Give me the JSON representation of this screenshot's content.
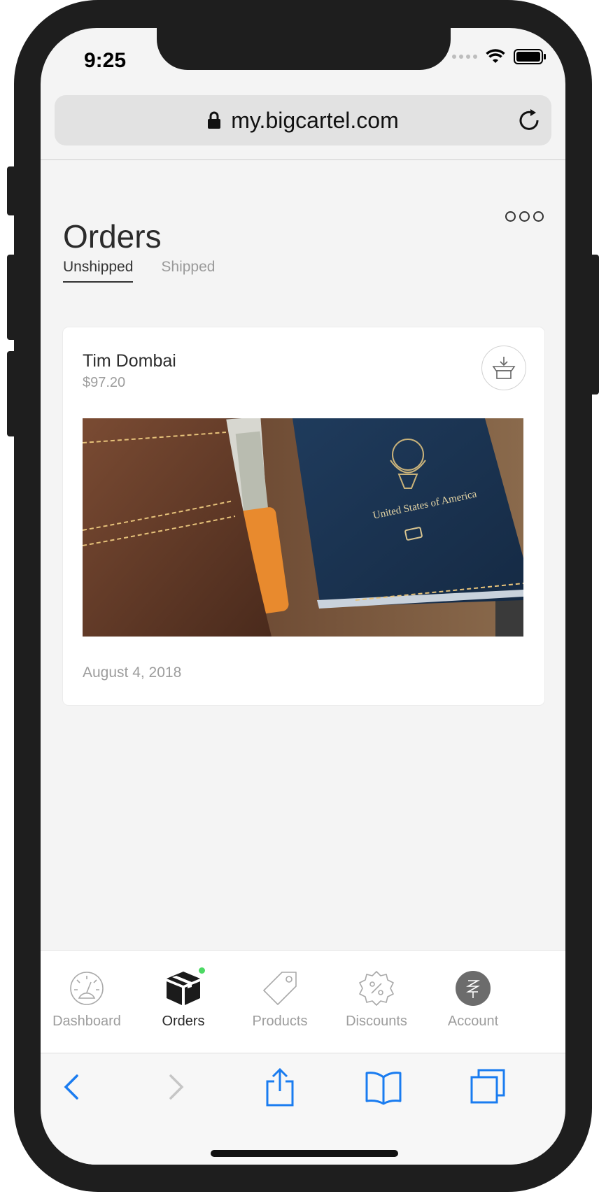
{
  "status": {
    "time": "9:25"
  },
  "browser": {
    "url": "my.bigcartel.com"
  },
  "page": {
    "title": "Orders",
    "tabs": [
      {
        "label": "Unshipped",
        "active": true
      },
      {
        "label": "Shipped",
        "active": false
      }
    ]
  },
  "order": {
    "customer": "Tim Dombai",
    "total": "$97.20",
    "date": "August 4, 2018",
    "image_text": "United States of America"
  },
  "tabbar": {
    "items": [
      {
        "label": "Dashboard",
        "icon": "gauge-icon"
      },
      {
        "label": "Orders",
        "icon": "box-icon",
        "active": true
      },
      {
        "label": "Products",
        "icon": "tag-icon"
      },
      {
        "label": "Discounts",
        "icon": "discount-badge-icon"
      },
      {
        "label": "Account",
        "icon": "account-avatar-icon"
      }
    ]
  },
  "colors": {
    "accent_blue": "#1a7cf0",
    "notification_dot": "#4cd964",
    "background": "#f4f4f4"
  }
}
